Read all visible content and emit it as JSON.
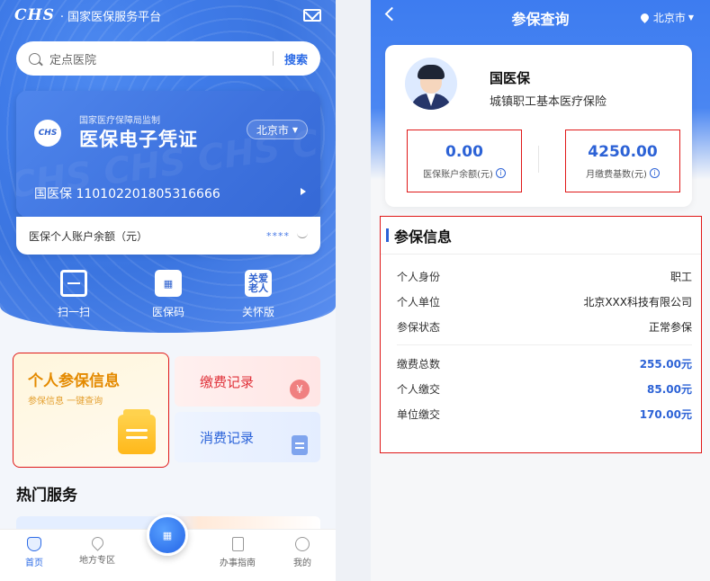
{
  "left": {
    "header": {
      "logo": "CHS",
      "platform": "· 国家医保服务平台",
      "mail_icon": "mail-icon"
    },
    "search": {
      "placeholder": "定点医院",
      "button": "搜索"
    },
    "ecard": {
      "badge": "CHS",
      "supervise": "国家医疗保障局监制",
      "title": "医保电子凭证",
      "city": "北京市",
      "number": "国医保  110102201805316666"
    },
    "balance": {
      "label": "医保个人账户余额（元）",
      "masked": "****"
    },
    "quick_actions": [
      {
        "label": "扫一扫",
        "icon": "scan-icon"
      },
      {
        "label": "医保码",
        "icon": "qr-code-icon"
      },
      {
        "label": "关怀版",
        "icon": "elder-care-icon",
        "icon_text": "关爱老人"
      }
    ],
    "tiles": {
      "personal": {
        "title": "个人参保信息",
        "subtitle": "参保信息 一键查询"
      },
      "payment": "缴费记录",
      "spending": "消费记录"
    },
    "hot_title": "热门服务",
    "tabbar": [
      {
        "label": "首页",
        "active": true
      },
      {
        "label": "地方专区",
        "active": false
      },
      {
        "label": "办事指南",
        "active": false
      },
      {
        "label": "我的",
        "active": false
      }
    ],
    "fab_icon": "qr-scan-icon"
  },
  "right": {
    "nav": {
      "title": "参保查询",
      "city": "北京市"
    },
    "person": {
      "name": "国医保",
      "insurance_type": "城镇职工基本医疗保险"
    },
    "stats": [
      {
        "value": "0.00",
        "label": "医保账户余额(元)"
      },
      {
        "value": "4250.00",
        "label": "月缴费基数(元)"
      }
    ],
    "info": {
      "title": "参保信息",
      "rows": [
        {
          "label": "个人身份",
          "value": "职工"
        },
        {
          "label": "个人单位",
          "value": "北京XXX科技有限公司"
        },
        {
          "label": "参保状态",
          "value": "正常参保"
        }
      ],
      "payments": [
        {
          "label": "缴费总数",
          "value": "255.00元"
        },
        {
          "label": "个人缴交",
          "value": "85.00元"
        },
        {
          "label": "单位缴交",
          "value": "170.00元"
        }
      ]
    }
  },
  "colors": {
    "brand_blue": "#2c6be6",
    "highlight_red": "#e01818",
    "orange": "#e48a00"
  }
}
